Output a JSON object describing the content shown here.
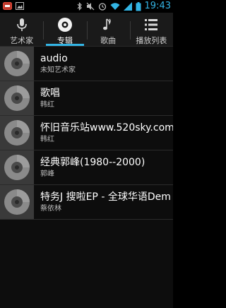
{
  "status_bar": {
    "time": "19:43",
    "left_icons": [
      "notification-badge-icon",
      "image-icon"
    ],
    "right_icons": [
      "bluetooth-icon",
      "mute-icon",
      "alarm-icon",
      "wifi-icon",
      "signal-icon",
      "battery-icon"
    ],
    "accent_color": "#33b5e5"
  },
  "tabs": [
    {
      "label": "艺术家",
      "icon": "microphone-icon",
      "active": false
    },
    {
      "label": "专辑",
      "icon": "album-disc-icon",
      "active": true
    },
    {
      "label": "歌曲",
      "icon": "music-note-icon",
      "active": false
    },
    {
      "label": "播放列表",
      "icon": "playlist-icon",
      "active": false
    }
  ],
  "albums": [
    {
      "title": "audio",
      "artist": "未知艺术家"
    },
    {
      "title": "歌唱",
      "artist": "韩红"
    },
    {
      "title": "怀旧音乐站www.520sky.com",
      "artist": "韩红"
    },
    {
      "title": "经典郭峰(1980--2000)",
      "artist": "郭峰"
    },
    {
      "title": "特务J 搜啦EP - 全球华语Dem",
      "artist": "蔡依林"
    }
  ]
}
